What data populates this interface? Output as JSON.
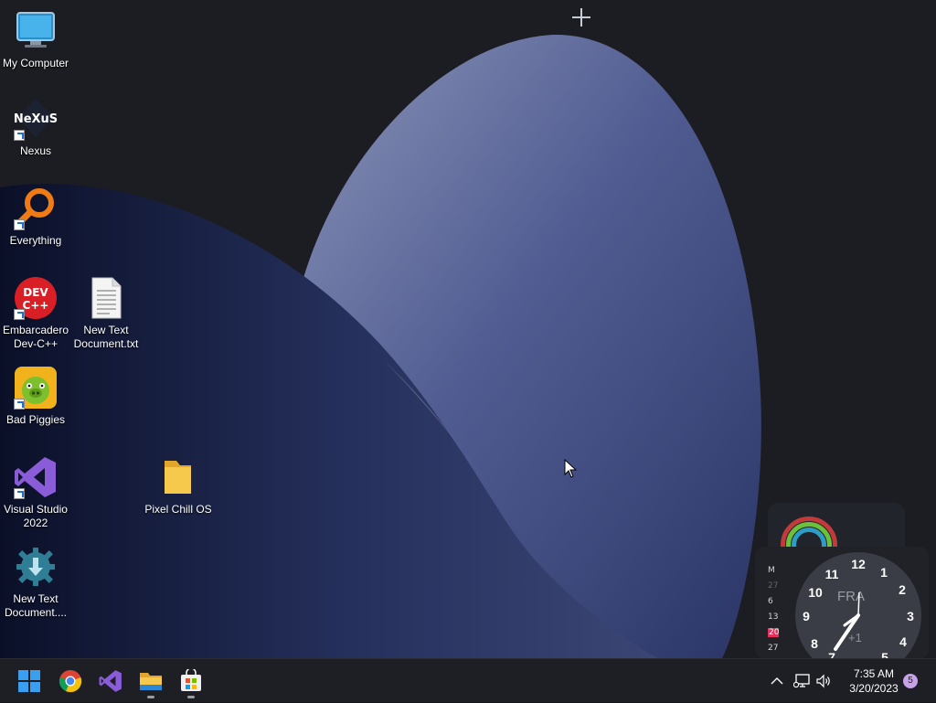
{
  "desktop": {
    "icons": [
      {
        "label": "My Computer",
        "icon": "monitor-icon"
      },
      {
        "label": "Nexus",
        "icon": "nexus-icon",
        "logo_text": "NeXuS"
      },
      {
        "label": "Everything",
        "icon": "magnifier-icon"
      },
      {
        "label": "Embarcadero\nDev-C++",
        "icon": "devcpp-icon",
        "logo_text": "DEV C++"
      },
      {
        "label": "New Text\nDocument.txt",
        "icon": "text-file-icon"
      },
      {
        "label": "Bad Piggies",
        "icon": "pig-icon"
      },
      {
        "label": "Visual Studio\n2022",
        "icon": "visual-studio-icon"
      },
      {
        "label": "Pixel Chill OS",
        "icon": "folder-icon"
      },
      {
        "label": "New Text\nDocument....",
        "icon": "gear-download-icon"
      }
    ]
  },
  "widget": {
    "calendar": {
      "header": "M",
      "rows": [
        "27",
        "6",
        "13",
        "20",
        "27"
      ],
      "second_col": [
        "2",
        "",
        "1",
        "2",
        "2"
      ],
      "today": "20"
    },
    "clock": {
      "numbers": [
        "12",
        "1",
        "2",
        "3",
        "4",
        "5",
        "7",
        "8",
        "9",
        "10",
        "11"
      ],
      "day": "FRA",
      "offset": "+1"
    }
  },
  "taskbar": {
    "items": [
      {
        "name": "start",
        "icon": "windows-start-icon"
      },
      {
        "name": "chrome",
        "icon": "chrome-icon"
      },
      {
        "name": "visual-studio",
        "icon": "visual-studio-icon"
      },
      {
        "name": "file-explorer",
        "icon": "folder-icon",
        "running": true
      },
      {
        "name": "microsoft-store",
        "icon": "store-icon",
        "running": true
      }
    ],
    "tray": {
      "time": "7:35 AM",
      "date": "3/20/2023",
      "notification_count": "5"
    }
  },
  "colors": {
    "accent": "#0078d4",
    "wallpaper_dark": "#1b1c21",
    "wallpaper_blue": "#3a4677"
  }
}
